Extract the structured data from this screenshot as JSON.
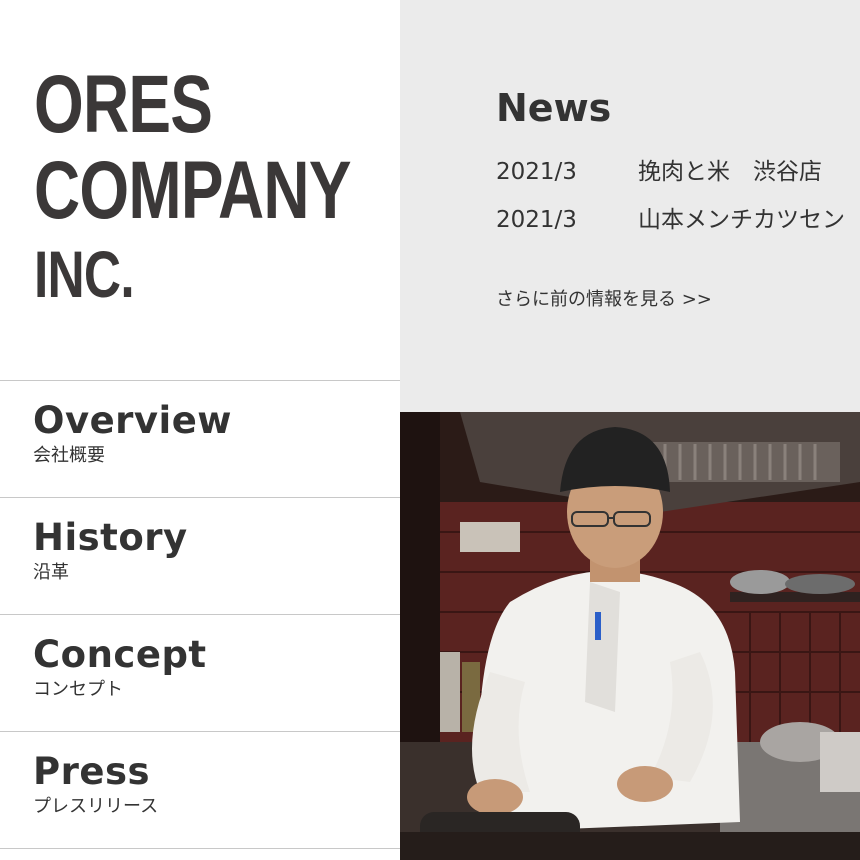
{
  "logo": {
    "line1": "ORES",
    "line2": "COMPANY",
    "line3": "INC."
  },
  "nav": {
    "items": [
      {
        "en": "Overview",
        "ja": "会社概要"
      },
      {
        "en": "History",
        "ja": "沿革"
      },
      {
        "en": "Concept",
        "ja": "コンセプト"
      },
      {
        "en": "Press",
        "ja": "プレスリリース"
      }
    ]
  },
  "news": {
    "title": "News",
    "items": [
      {
        "date": "2021/3",
        "text": "挽肉と米　渋谷店"
      },
      {
        "date": "2021/3",
        "text": "山本メンチカツセン"
      }
    ],
    "more_link": "さらに前の情報を見る >>"
  },
  "colors": {
    "news_bg": "#ebebeb",
    "text": "#333333",
    "divider": "#c8c8c8"
  }
}
